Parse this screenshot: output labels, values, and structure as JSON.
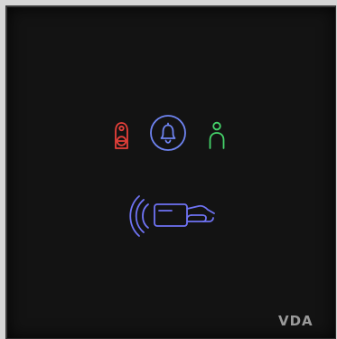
{
  "device": {
    "brand_logo": "VDA",
    "indicators": {
      "do_not_disturb": {
        "icon": "do-not-disturb-hanger-icon",
        "color": "#e8403a"
      },
      "doorbell": {
        "icon": "doorbell-icon",
        "color": "#6f84f2"
      },
      "presence": {
        "icon": "person-presence-icon",
        "color": "#45d36a"
      },
      "card_reader": {
        "icon": "contactless-card-icon",
        "color": "#6f73f4"
      }
    },
    "panel_color": "#131313"
  }
}
